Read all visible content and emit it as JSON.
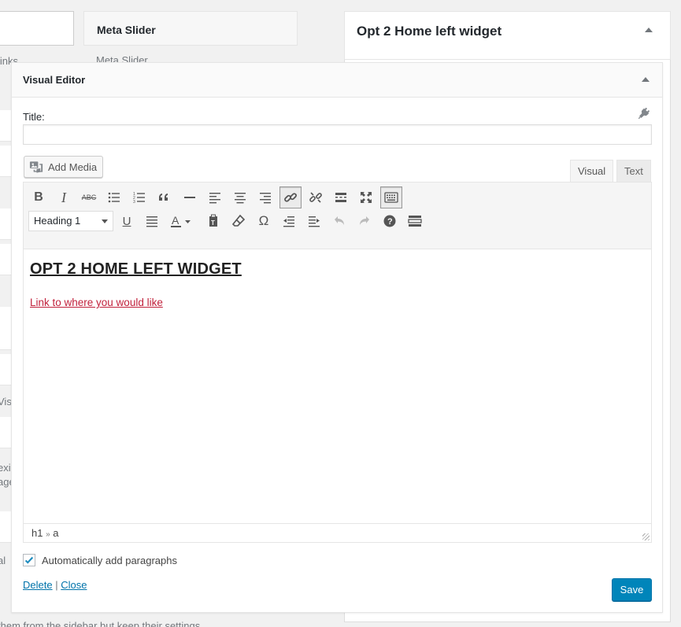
{
  "background": {
    "meta_slider_title": "Meta Slider",
    "meta_slider_desc": "Meta Slider",
    "frag_links": "links",
    "frag_visu": "Visu",
    "frag_exis": "exis",
    "frag_age": "age",
    "frag_al": "al",
    "bottom_text": "them from the sidebar but keep their settings.",
    "opt2_title": "Opt 2 Home left widget"
  },
  "widget": {
    "title": "Visual Editor",
    "title_label": "Title:",
    "title_value": "",
    "add_media": "Add Media",
    "tabs": {
      "visual": "Visual",
      "text": "Text"
    },
    "format_select": "Heading 1",
    "content": {
      "heading": "OPT 2 HOME LEFT WIDGET",
      "link_text": "Link to where you would like"
    },
    "statusbar": {
      "path1": "h1",
      "sep": "»",
      "path2": "a"
    },
    "auto_paragraphs_label": "Automatically add paragraphs",
    "auto_paragraphs_checked": true,
    "delete_label": "Delete",
    "divider": "|",
    "close_label": "Close",
    "save_label": "Save"
  },
  "toolbar_icons": {
    "row1": [
      "bold-icon",
      "italic-icon",
      "strikethrough-icon",
      "bullet-list-icon",
      "numbered-list-icon",
      "blockquote-icon",
      "horizontal-rule-icon",
      "align-left-icon",
      "align-center-icon",
      "align-right-icon",
      "insert-link-icon",
      "remove-link-icon",
      "read-more-icon",
      "fullscreen-icon",
      "toolbar-toggle-icon"
    ],
    "row2": [
      "underline-icon",
      "justify-icon",
      "text-color-icon",
      "paste-as-text-icon",
      "clear-formatting-icon",
      "special-character-icon",
      "outdent-icon",
      "indent-icon",
      "undo-icon",
      "redo-icon",
      "help-icon",
      "kitchen-sink-icon"
    ]
  },
  "colors": {
    "accent": "#0085ba",
    "link": "#0073aa",
    "content_link": "#c1203b"
  }
}
